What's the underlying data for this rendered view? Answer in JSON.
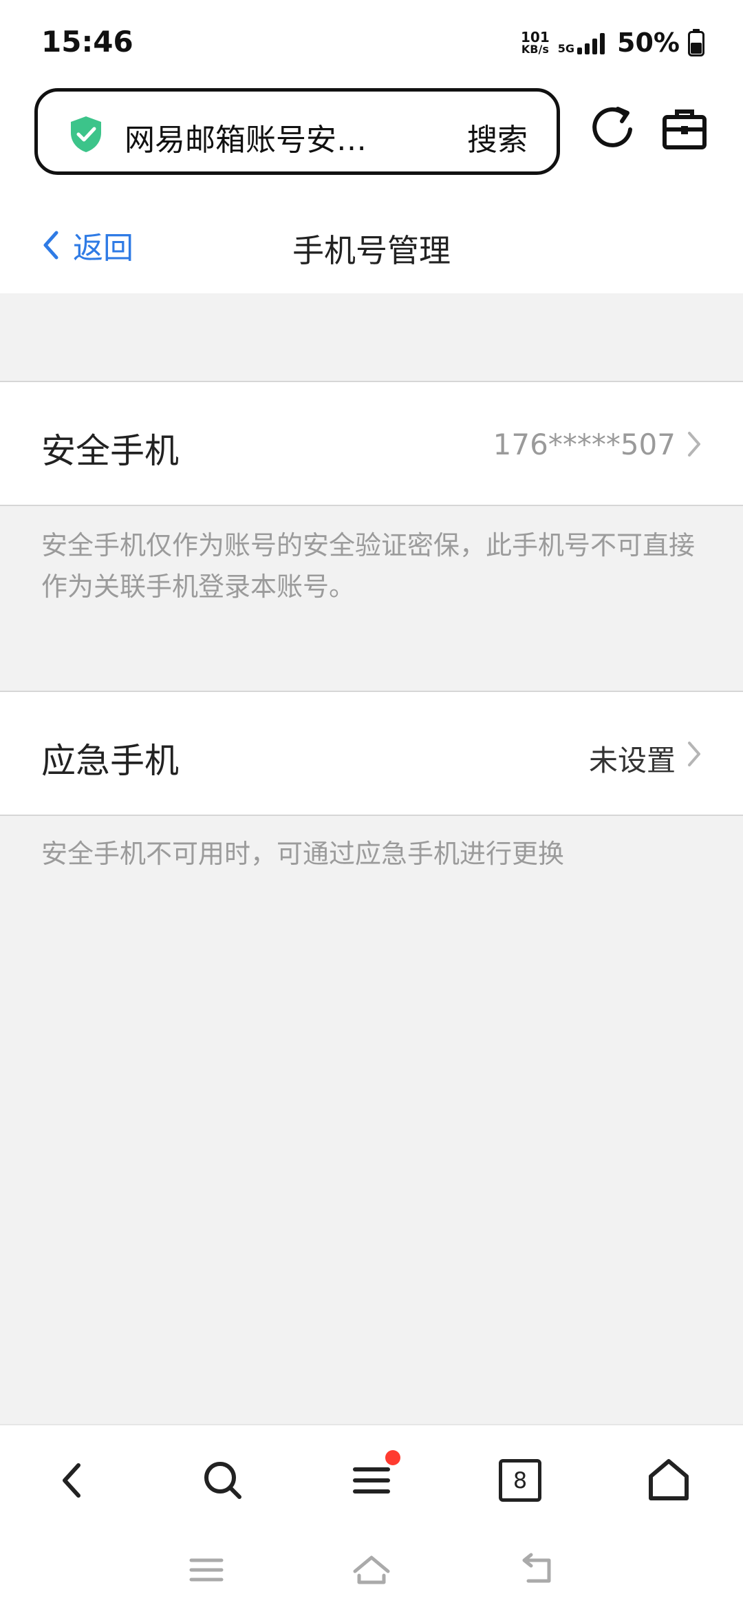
{
  "status_bar": {
    "time": "15:46",
    "net_speed_value": "101",
    "net_speed_unit": "KB/s",
    "network": "5G",
    "battery": "50%"
  },
  "browser": {
    "url_title": "网易邮箱账号安…",
    "search_label": "搜索"
  },
  "header": {
    "back_label": "返回",
    "title": "手机号管理"
  },
  "security_phone": {
    "label": "安全手机",
    "value": "176*****507",
    "note": "安全手机仅作为账号的安全验证密保，此手机号不可直接作为关联手机登录本账号。"
  },
  "emergency_phone": {
    "label": "应急手机",
    "value": "未设置",
    "note": "安全手机不可用时，可通过应急手机进行更换"
  },
  "bottom_nav": {
    "tab_count": "8"
  },
  "colors": {
    "accent": "#2f7be5",
    "shield": "#3cc48a",
    "badge": "#ff3b30",
    "background": "#f2f2f2"
  }
}
